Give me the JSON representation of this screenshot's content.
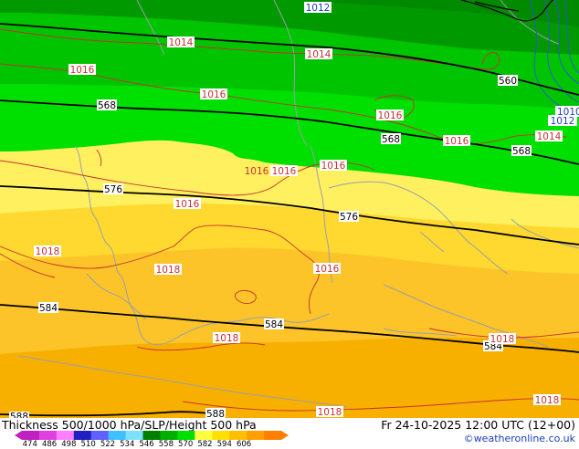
{
  "footer": {
    "title": "Thickness 500/1000 hPa/SLP/Height 500 hPa",
    "valid_time": "Fr 24-10-2025 12:00 UTC (12+00)",
    "credit": "©weatheronline.co.uk"
  },
  "legend": {
    "ticks": [
      "474",
      "486",
      "498",
      "510",
      "522",
      "534",
      "546",
      "558",
      "570",
      "582",
      "594",
      "606"
    ],
    "colors": [
      "#c020c0",
      "#e040e0",
      "#ff80ff",
      "#2020c0",
      "#6060ff",
      "#40c0ff",
      "#80e0ff",
      "#008000",
      "#00b000",
      "#00e000",
      "#ffff40",
      "#ffe000",
      "#ffc000",
      "#ffa000",
      "#ff8000"
    ]
  },
  "map": {
    "fill_colors": {
      "dark_green": "#009a00",
      "mid_green": "#00c400",
      "bright_green": "#00e000",
      "yellow_light": "#fff060",
      "yellow": "#ffd830",
      "orange_light": "#fcc428",
      "orange": "#f8b000"
    },
    "height_labels": [
      "568",
      "560",
      "568",
      "568",
      "576",
      "576",
      "584",
      "584",
      "584",
      "588",
      "588"
    ],
    "pressure_labels": [
      "1012",
      "1014",
      "1014",
      "1016",
      "1016",
      "1016",
      "1016",
      "1016",
      "1016",
      "1016",
      "1016",
      "1016",
      "1018",
      "1018",
      "1018",
      "1018",
      "1018",
      "1018",
      "1010",
      "1012",
      "1014"
    ]
  }
}
